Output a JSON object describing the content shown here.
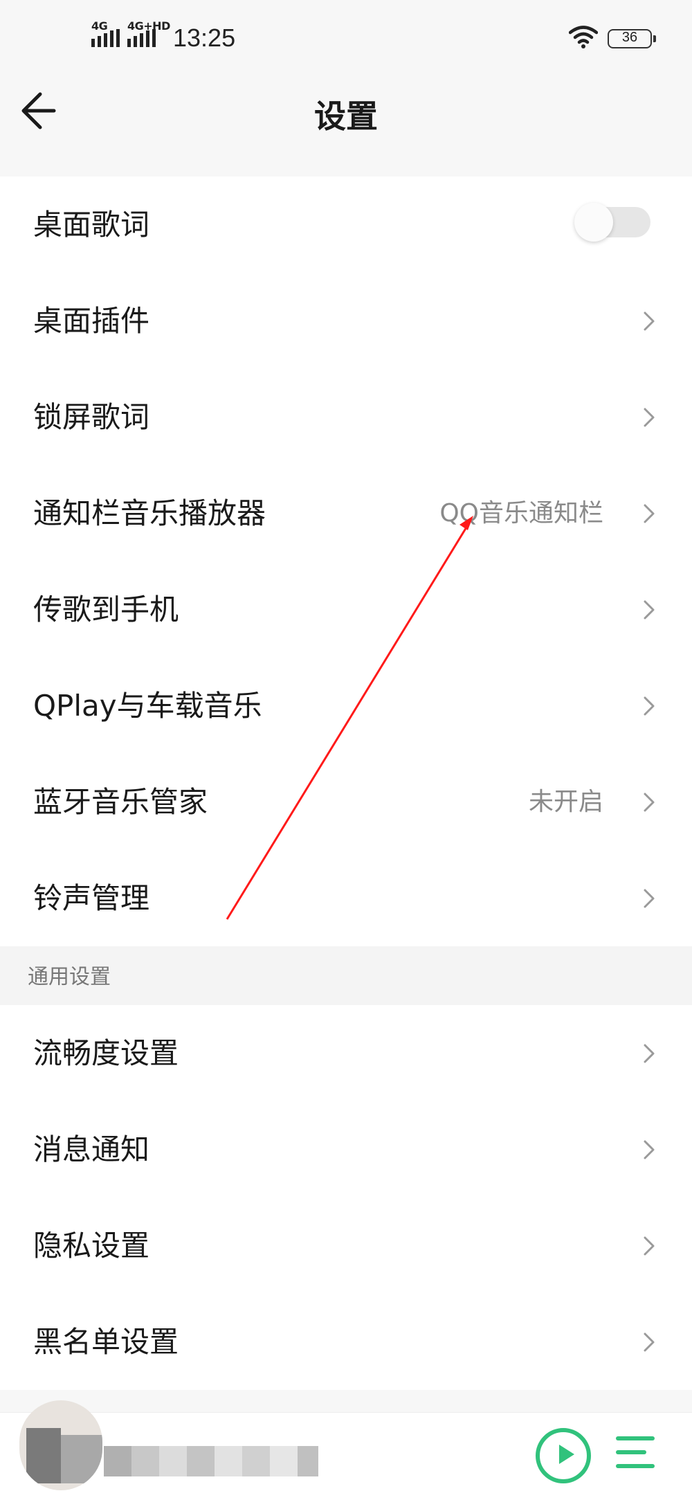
{
  "status_bar": {
    "sim1_label": "4G",
    "sim2_label": "4G+HD",
    "time": "13:25",
    "battery": "36"
  },
  "header": {
    "title": "设置"
  },
  "settings_group_1": [
    {
      "label": "桌面歌词",
      "type": "toggle",
      "on": false
    },
    {
      "label": "桌面插件",
      "type": "link"
    },
    {
      "label": "锁屏歌词",
      "type": "link"
    },
    {
      "label": "通知栏音乐播放器",
      "type": "link",
      "value": "QQ音乐通知栏"
    },
    {
      "label": "传歌到手机",
      "type": "link"
    },
    {
      "label": "QPlay与车载音乐",
      "type": "link"
    },
    {
      "label": "蓝牙音乐管家",
      "type": "link",
      "value": "未开启"
    },
    {
      "label": "铃声管理",
      "type": "link"
    }
  ],
  "section_general": {
    "title": "通用设置"
  },
  "settings_group_2": [
    {
      "label": "流畅度设置",
      "type": "link"
    },
    {
      "label": "消息通知",
      "type": "link"
    },
    {
      "label": "隐私设置",
      "type": "link"
    },
    {
      "label": "黑名单设置",
      "type": "link"
    }
  ],
  "mini_player": {
    "play_icon": "play-circle-icon",
    "playlist_icon": "playlist-icon"
  },
  "colors": {
    "accent": "#31c27c",
    "annotation_arrow": "#ff1a1a",
    "secondary_text": "#8a8a8a",
    "section_header_bg": "#f4f4f4"
  },
  "icons": {
    "back": "back-arrow-icon",
    "chevron": "chevron-right-icon",
    "wifi": "wifi-icon",
    "battery": "battery-icon"
  }
}
